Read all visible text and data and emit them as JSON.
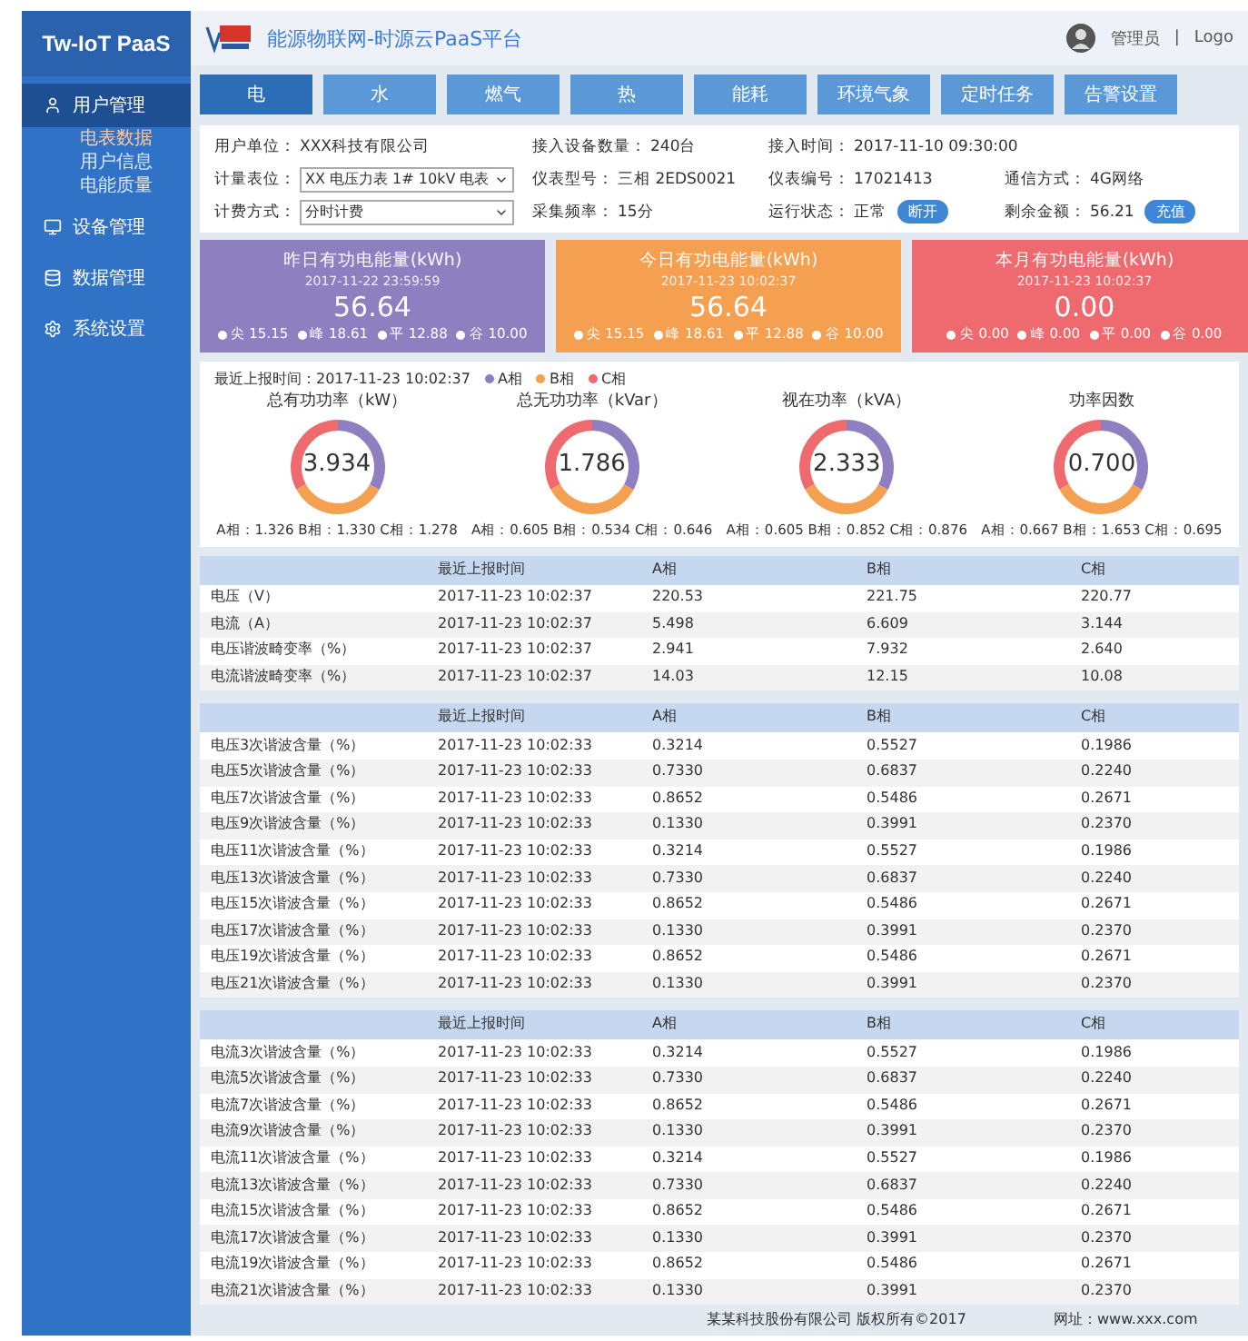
{
  "sidebar": {
    "brand": "Tw-IoT PaaS",
    "items": [
      {
        "label": "用户管理",
        "selected": true,
        "children": [
          {
            "label": "电表数据",
            "selected": true
          },
          {
            "label": "用户信息",
            "selected": false
          },
          {
            "label": "电能质量",
            "selected": false
          }
        ]
      },
      {
        "label": "设备管理",
        "selected": false
      },
      {
        "label": "数据管理",
        "selected": false
      },
      {
        "label": "系统设置",
        "selected": false
      }
    ]
  },
  "header": {
    "title": "能源物联网-时源云PaaS平台",
    "user": "管理员",
    "separator": "|",
    "logout": "Logo"
  },
  "tabs": [
    {
      "label": "电",
      "selected": true
    },
    {
      "label": "水",
      "selected": false
    },
    {
      "label": "燃气",
      "selected": false
    },
    {
      "label": "热",
      "selected": false
    },
    {
      "label": "能耗",
      "selected": false
    },
    {
      "label": "环境气象",
      "selected": false
    },
    {
      "label": "定时任务",
      "selected": false
    },
    {
      "label": "告警设置",
      "selected": false
    }
  ],
  "info": [
    [
      {
        "kind": "text",
        "label": "用户单位：",
        "value": "XXX科技有限公司"
      },
      {
        "kind": "text",
        "label": "接入设备数量：",
        "value": "240台"
      },
      {
        "kind": "text",
        "label": "接入时间：",
        "value": "2017-11-10  09:30:00"
      }
    ],
    [
      {
        "kind": "select",
        "label": "计量表位：",
        "value": "XX 电压力表 1# 10kV 电表"
      },
      {
        "kind": "text",
        "label": "仪表型号：",
        "value": "三相 2EDS0021"
      },
      {
        "kind": "text",
        "label": "仪表编号：",
        "value": "17021413"
      },
      {
        "kind": "text",
        "label": "通信方式：",
        "value": "4G网络"
      }
    ],
    [
      {
        "kind": "select",
        "label": "计费方式：",
        "value": "分时计费"
      },
      {
        "kind": "text",
        "label": "采集频率：",
        "value": "15分"
      },
      {
        "kind": "button",
        "label": "运行状态：",
        "value": "正常",
        "button": "断开"
      },
      {
        "kind": "button",
        "label": "剩余金额：",
        "value": "56.21",
        "button": "充值"
      }
    ]
  ],
  "cards": [
    {
      "title": "昨日有功电能量(kWh)",
      "date": "2017-11-22 23:59:59",
      "value": "56.64",
      "color": "#8e7fc0",
      "legend": [
        "尖 15.15",
        "峰 18.61",
        "平 12.88",
        "谷 10.00"
      ]
    },
    {
      "title": "今日有功电能量(kWh)",
      "date": "2017-11-23 10:02:37",
      "value": "56.64",
      "color": "#f4a050",
      "legend": [
        "尖 15.15",
        "峰 18.61",
        "平 12.88",
        "谷 10.00"
      ]
    },
    {
      "title": "本月有功电能量(kWh)",
      "date": "2017-11-23 10:02:37",
      "value": "0.00",
      "color": "#ee6a6e",
      "legend": [
        "尖 0.00",
        "峰 0.00",
        "平 0.00",
        "谷 0.00"
      ]
    }
  ],
  "gauges": {
    "updated": "最近上报时间：2017-11-23 10:02:37",
    "legend": [
      {
        "label": "A相",
        "color": "#8e7fc0"
      },
      {
        "label": "B相",
        "color": "#f4a050"
      },
      {
        "label": "C相",
        "color": "#ee6a6e"
      }
    ],
    "items": [
      {
        "title": "总有功功率（kW）",
        "value": "3.934",
        "readings": "A相：1.326  B相：1.330  C相：1.278"
      },
      {
        "title": "总无功功率（kVar）",
        "value": "1.786",
        "readings": "A相：0.605  B相：0.534  C相：0.646"
      },
      {
        "title": "视在功率（kVA）",
        "value": "2.333",
        "readings": "A相：0.605  B相：0.852  C相：0.876"
      },
      {
        "title": "功率因数",
        "value": "0.700",
        "readings": "A相：0.667  B相：1.653  C相：0.695"
      }
    ]
  },
  "tables": [
    {
      "columns": [
        "",
        "最近上报时间",
        "A相",
        "B相",
        "C相"
      ],
      "rows": [
        [
          "电压（V）",
          "2017-11-23 10:02:37",
          "220.53",
          "221.75",
          "220.77"
        ],
        [
          "电流（A）",
          "2017-11-23 10:02:37",
          "5.498",
          "6.609",
          "3.144"
        ],
        [
          "电压谐波畸变率（%）",
          "2017-11-23 10:02:37",
          "2.941",
          "7.932",
          "2.640"
        ],
        [
          "电流谐波畸变率（%）",
          "2017-11-23 10:02:37",
          "14.03",
          "12.15",
          "10.08"
        ]
      ]
    },
    {
      "columns": [
        "",
        "最近上报时间",
        "A相",
        "B相",
        "C相"
      ],
      "rows": [
        [
          "电压3次谐波含量（%）",
          "2017-11-23 10:02:33",
          "0.3214",
          "0.5527",
          "0.1986"
        ],
        [
          "电压5次谐波含量（%）",
          "2017-11-23 10:02:33",
          "0.7330",
          "0.6837",
          "0.2240"
        ],
        [
          "电压7次谐波含量（%）",
          "2017-11-23 10:02:33",
          "0.8652",
          "0.5486",
          "0.2671"
        ],
        [
          "电压9次谐波含量（%）",
          "2017-11-23 10:02:33",
          "0.1330",
          "0.3991",
          "0.2370"
        ],
        [
          "电压11次谐波含量（%）",
          "2017-11-23 10:02:33",
          "0.3214",
          "0.5527",
          "0.1986"
        ],
        [
          "电压13次谐波含量（%）",
          "2017-11-23 10:02:33",
          "0.7330",
          "0.6837",
          "0.2240"
        ],
        [
          "电压15次谐波含量（%）",
          "2017-11-23 10:02:33",
          "0.8652",
          "0.5486",
          "0.2671"
        ],
        [
          "电压17次谐波含量（%）",
          "2017-11-23 10:02:33",
          "0.1330",
          "0.3991",
          "0.2370"
        ],
        [
          "电压19次谐波含量（%）",
          "2017-11-23 10:02:33",
          "0.8652",
          "0.5486",
          "0.2671"
        ],
        [
          "电压21次谐波含量（%）",
          "2017-11-23 10:02:33",
          "0.1330",
          "0.3991",
          "0.2370"
        ]
      ]
    },
    {
      "columns": [
        "",
        "最近上报时间",
        "A相",
        "B相",
        "C相"
      ],
      "rows": [
        [
          "电流3次谐波含量（%）",
          "2017-11-23 10:02:33",
          "0.3214",
          "0.5527",
          "0.1986"
        ],
        [
          "电流5次谐波含量（%）",
          "2017-11-23 10:02:33",
          "0.7330",
          "0.6837",
          "0.2240"
        ],
        [
          "电流7次谐波含量（%）",
          "2017-11-23 10:02:33",
          "0.8652",
          "0.5486",
          "0.2671"
        ],
        [
          "电流9次谐波含量（%）",
          "2017-11-23 10:02:33",
          "0.1330",
          "0.3991",
          "0.2370"
        ],
        [
          "电流11次谐波含量（%）",
          "2017-11-23 10:02:33",
          "0.3214",
          "0.5527",
          "0.1986"
        ],
        [
          "电流13次谐波含量（%）",
          "2017-11-23 10:02:33",
          "0.7330",
          "0.6837",
          "0.2240"
        ],
        [
          "电流15次谐波含量（%）",
          "2017-11-23 10:02:33",
          "0.8652",
          "0.5486",
          "0.2671"
        ],
        [
          "电流17次谐波含量（%）",
          "2017-11-23 10:02:33",
          "0.1330",
          "0.3991",
          "0.2370"
        ],
        [
          "电流19次谐波含量（%）",
          "2017-11-23 10:02:33",
          "0.8652",
          "0.5486",
          "0.2671"
        ],
        [
          "电流21次谐波含量（%）",
          "2017-11-23 10:02:33",
          "0.1330",
          "0.3991",
          "0.2370"
        ]
      ]
    }
  ],
  "footer": {
    "copyright": "某某科技股份有限公司  版权所有©2017",
    "site": "网址：www.xxx.com"
  }
}
